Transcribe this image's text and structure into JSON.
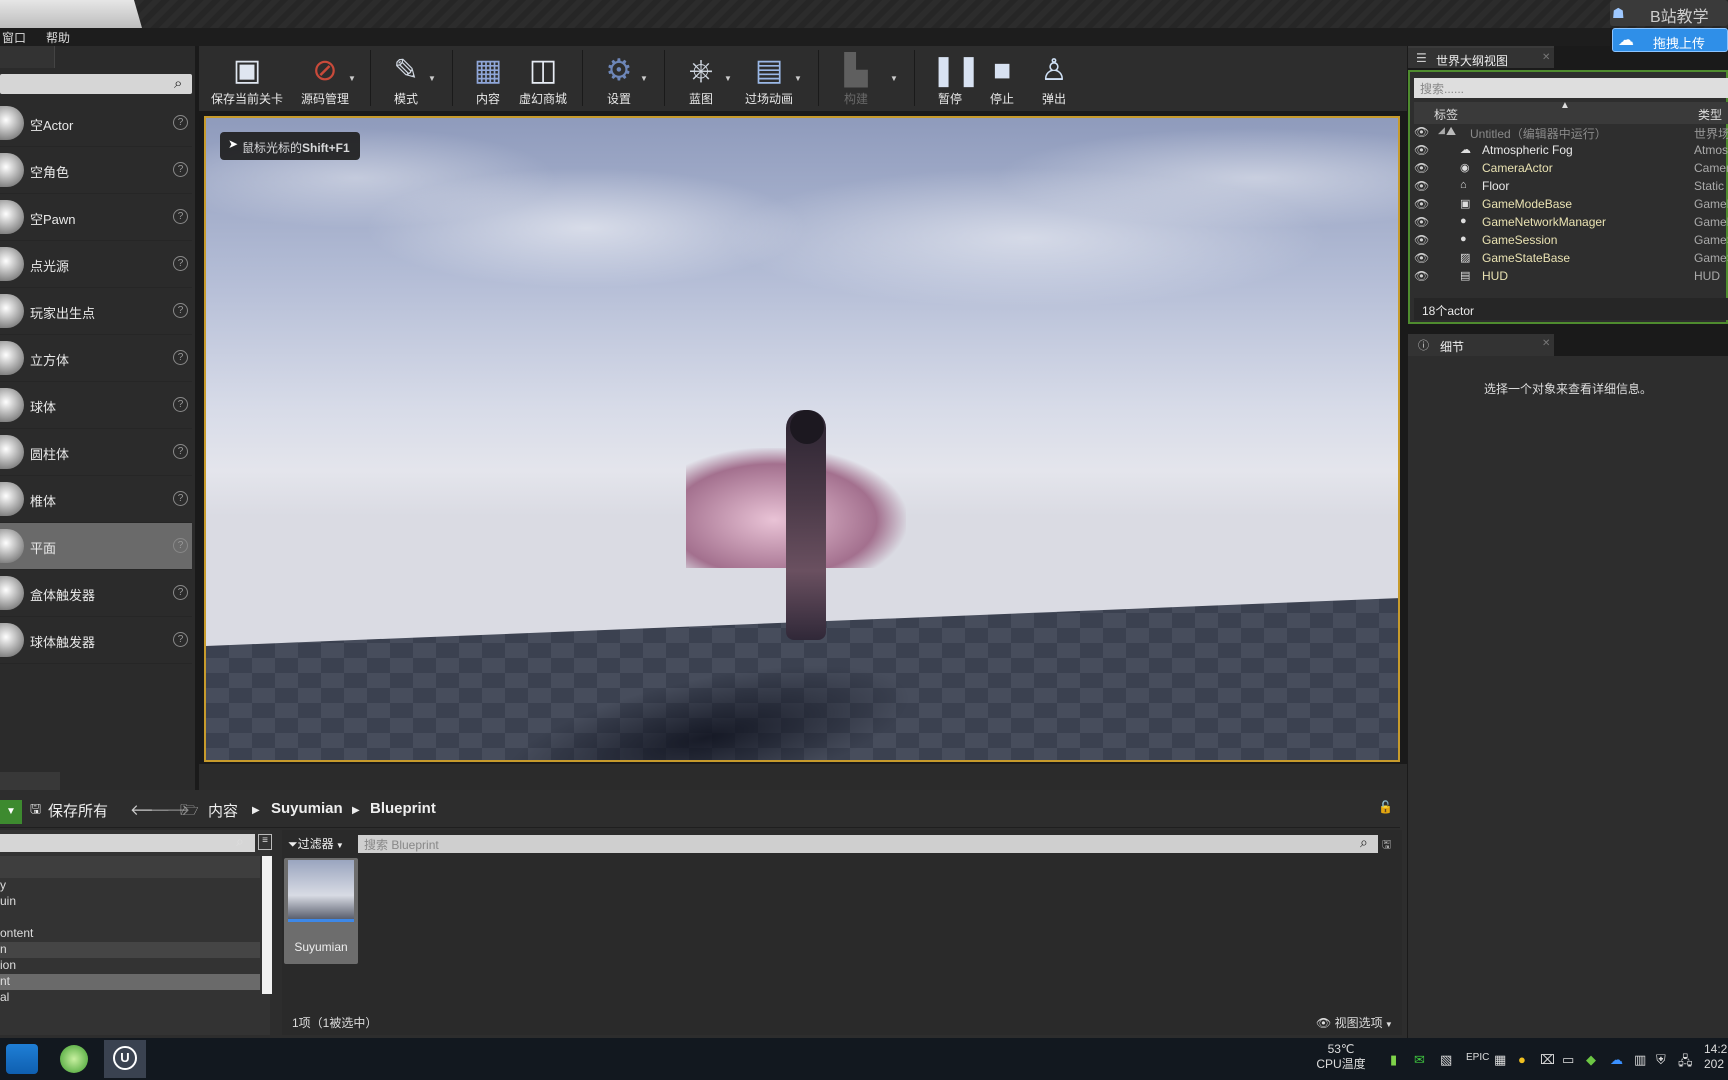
{
  "window": {
    "tab_title": "",
    "bilibili_label": "B站教学",
    "upload_label": "拖拽上传"
  },
  "menu": {
    "items": [
      "窗口",
      "帮助"
    ]
  },
  "modes": {
    "items": [
      {
        "label": "空Actor"
      },
      {
        "label": "空角色"
      },
      {
        "label": "空Pawn"
      },
      {
        "label": "点光源"
      },
      {
        "label": "玩家出生点"
      },
      {
        "label": "立方体"
      },
      {
        "label": "球体"
      },
      {
        "label": "圆柱体"
      },
      {
        "label": "椎体"
      },
      {
        "label": "平面"
      },
      {
        "label": "盒体触发器"
      },
      {
        "label": "球体触发器"
      }
    ],
    "selected_index": 9,
    "help_glyph": "?"
  },
  "toolbar": {
    "save_level": "保存当前关卡",
    "source_control": "源码管理",
    "modes": "模式",
    "content": "内容",
    "marketplace": "虚幻商城",
    "settings": "设置",
    "blueprints": "蓝图",
    "cinematics": "过场动画",
    "build": "构建",
    "pause": "暂停",
    "stop": "停止",
    "eject": "弹出"
  },
  "viewport": {
    "hint_prefix": "鼠标光标的",
    "hint_key": "Shift+F1"
  },
  "content_browser": {
    "save_all": "保存所有",
    "breadcrumb": [
      "内容",
      "Suyumian",
      "Blueprint"
    ],
    "filter_label": "过滤器",
    "search_placeholder": "搜索 Blueprint",
    "tree_rows": [
      "y",
      "uin",
      "ontent",
      "n",
      "ion",
      "nt",
      "al"
    ],
    "asset_name": "Suyumian",
    "status": "1项（1被选中）",
    "view_options": "视图选项"
  },
  "outliner": {
    "tab_label": "世界大纲视图",
    "search_placeholder": "搜索......",
    "col_label": "标签",
    "col_type": "类型",
    "root_name": "Untitled（编辑器中运行）",
    "root_type": "世界场",
    "rows": [
      {
        "name": "Atmospheric Fog",
        "type": "Atmos",
        "icon": "fog-icon",
        "style": "white"
      },
      {
        "name": "CameraActor",
        "type": "Camer",
        "icon": "camera-icon",
        "style": "yellow"
      },
      {
        "name": "Floor",
        "type": "Static",
        "icon": "mesh-icon",
        "style": "white"
      },
      {
        "name": "GameModeBase",
        "type": "GameM",
        "icon": "gamemode-icon",
        "style": "yellow"
      },
      {
        "name": "GameNetworkManager",
        "type": "GameN",
        "icon": "sphere-icon",
        "style": "yellow"
      },
      {
        "name": "GameSession",
        "type": "GameS",
        "icon": "sphere-icon",
        "style": "yellow"
      },
      {
        "name": "GameStateBase",
        "type": "GameS",
        "icon": "chart-icon",
        "style": "yellow"
      },
      {
        "name": "HUD",
        "type": "HUD",
        "icon": "hud-icon",
        "style": "yellow"
      }
    ],
    "count": "18个actor"
  },
  "details": {
    "tab_label": "细节",
    "empty_message": "选择一个对象来查看详细信息。"
  },
  "taskbar": {
    "temp_value": "53℃",
    "temp_label": "CPU温度",
    "ime": "英",
    "time": "14:2",
    "date": "202"
  },
  "colors": {
    "viewport_border": "#c79b2c",
    "outliner_border": "#4f8c2f",
    "selection_blue": "#3d88e8",
    "add_green": "#3d8a2f"
  }
}
